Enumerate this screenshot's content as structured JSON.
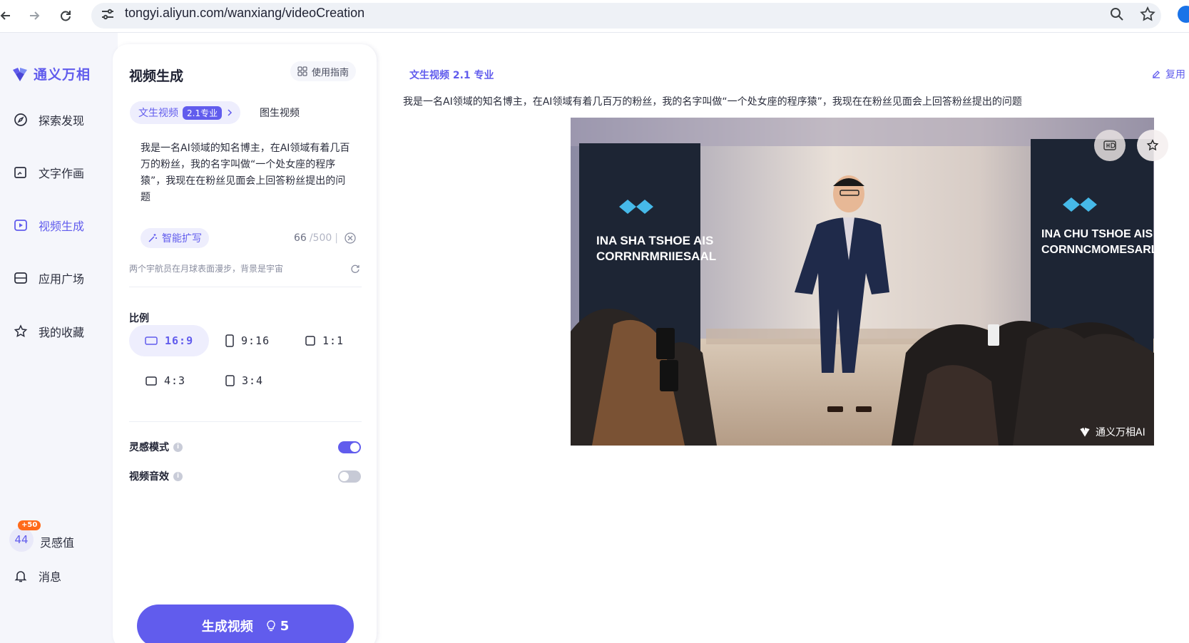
{
  "browser": {
    "url": "tongyi.aliyun.com/wanxiang/videoCreation"
  },
  "sidebar": {
    "brand": "通义万相",
    "items": [
      {
        "label": "探索发现",
        "icon": "compass-icon"
      },
      {
        "label": "文字作画",
        "icon": "image-edit-icon"
      },
      {
        "label": "视频生成",
        "icon": "video-play-icon",
        "active": true
      },
      {
        "label": "应用广场",
        "icon": "apps-icon"
      },
      {
        "label": "我的收藏",
        "icon": "star-icon"
      }
    ],
    "points": {
      "value": "44",
      "badge": "+50",
      "label": "灵感值"
    },
    "messages": {
      "label": "消息",
      "icon": "bell-icon"
    }
  },
  "panel": {
    "title": "视频生成",
    "guide_label": "使用指南",
    "tabs": [
      {
        "label": "文生视频",
        "badge": "2.1专业",
        "active": true
      },
      {
        "label": "图生视频"
      }
    ],
    "prompt_text": "我是一名AI领域的知名博主，在AI领域有着几百万的粉丝，我的名字叫做“一个处女座的程序猿”，我现在在粉丝见面会上回答粉丝提出的问题",
    "expand_label": "智能扩写",
    "char_count": "66",
    "char_max": "/500",
    "hint": "两个宇航员在月球表面漫步，背景是宇宙",
    "ratio_label": "比例",
    "ratios": [
      {
        "label": "16:9",
        "active": true
      },
      {
        "label": "9:16"
      },
      {
        "label": "1:1"
      },
      {
        "label": "4:3"
      },
      {
        "label": "3:4"
      }
    ],
    "toggles": [
      {
        "label": "灵感模式",
        "on": true
      },
      {
        "label": "视频音效",
        "on": false
      }
    ],
    "generate_label": "生成视频",
    "generate_cost": "5"
  },
  "result": {
    "title": "文生视频 2.1 专业",
    "reuse_label": "复用",
    "prompt": "我是一名AI领域的知名博主，在AI领域有着几百万的粉丝，我的名字叫做“一个处女座的程序猿”，我现在在粉丝见面会上回答粉丝提出的问题",
    "video": {
      "banner_left_line1": "INA SHA TSHOE AIS",
      "banner_left_line2": "CORRNRMRIIESAAL",
      "banner_right_line1": "INA CHU TSHOE AIS",
      "banner_right_line2": "CORNNCMOMESARL",
      "watermark": "通义万相AI"
    }
  },
  "colors": {
    "accent": "#615ced",
    "badge_orange": "#ff6a1a"
  }
}
